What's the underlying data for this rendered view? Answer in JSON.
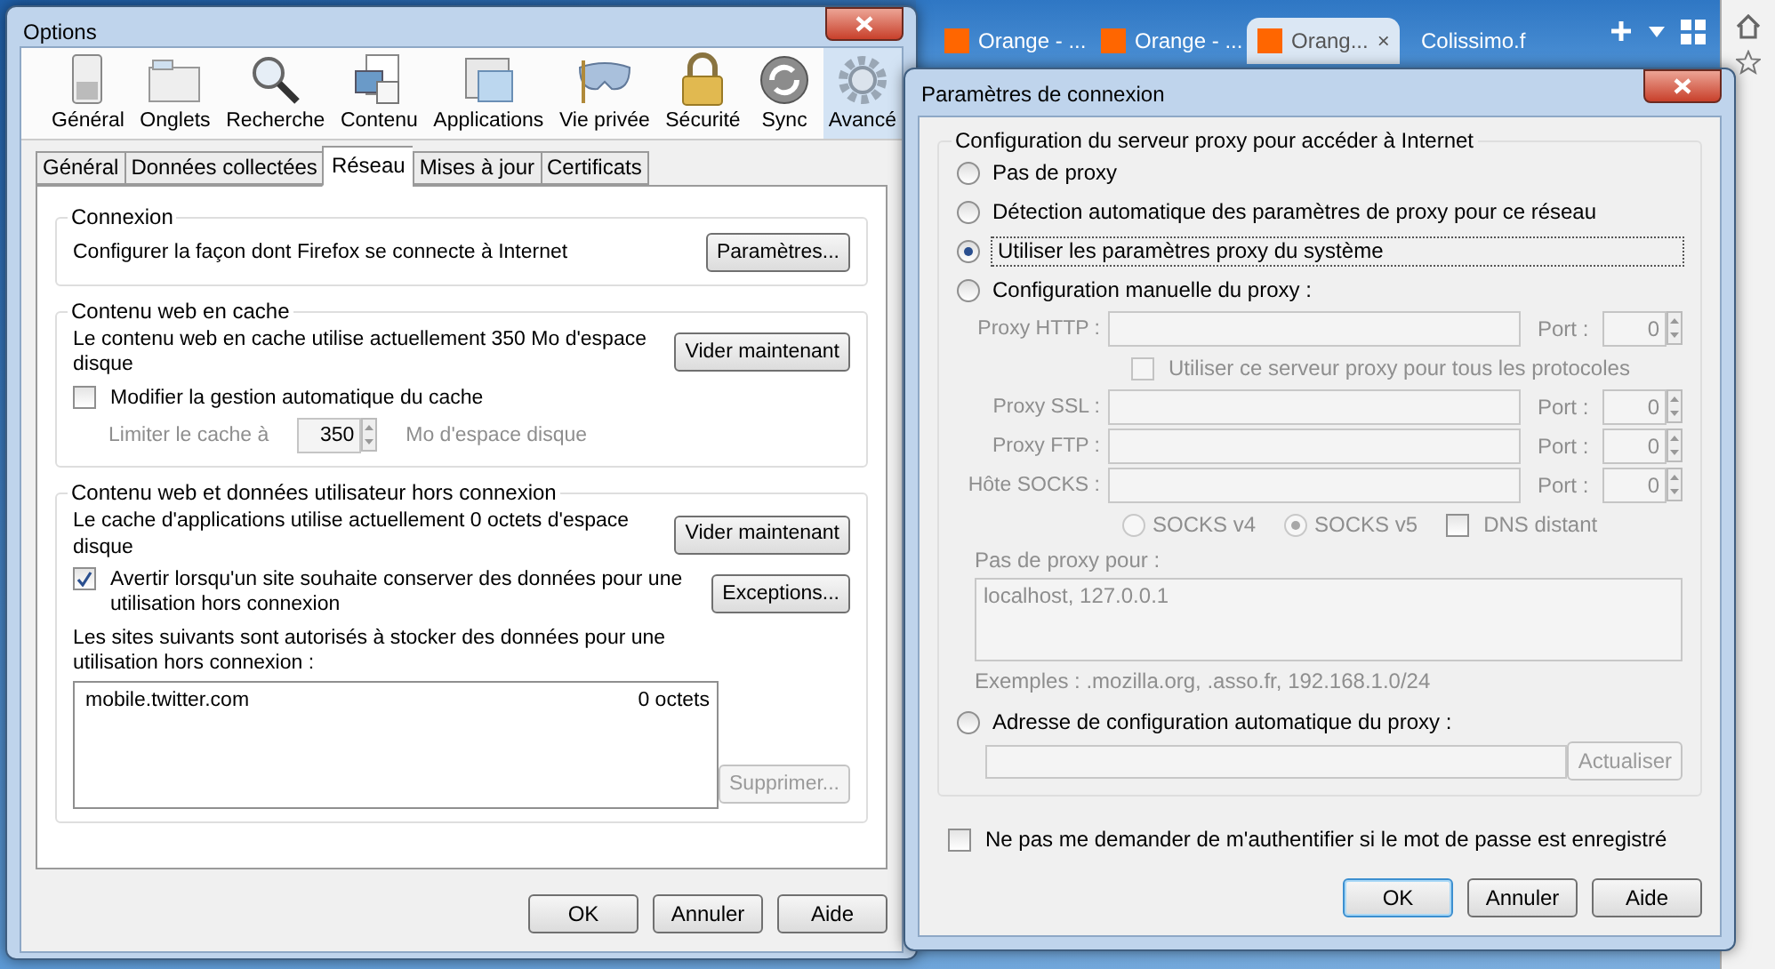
{
  "browser_tabs": [
    {
      "label": "Orange - ...",
      "favicon": true,
      "selected": false
    },
    {
      "label": "Orange - ...",
      "favicon": true,
      "selected": false
    },
    {
      "label": "Orang...",
      "favicon": true,
      "selected": true,
      "close": "×"
    },
    {
      "label": "Colissimo.f",
      "favicon": false,
      "selected": false
    }
  ],
  "options": {
    "title": "Options",
    "toolbar": [
      {
        "label": "Général",
        "kind": "general",
        "selected": false
      },
      {
        "label": "Onglets",
        "kind": "tabs",
        "selected": false
      },
      {
        "label": "Recherche",
        "kind": "search",
        "selected": false
      },
      {
        "label": "Contenu",
        "kind": "content",
        "selected": false
      },
      {
        "label": "Applications",
        "kind": "apps",
        "selected": false
      },
      {
        "label": "Vie privée",
        "kind": "privacy",
        "selected": false
      },
      {
        "label": "Sécurité",
        "kind": "security",
        "selected": false
      },
      {
        "label": "Sync",
        "kind": "sync",
        "selected": false
      },
      {
        "label": "Avancé",
        "kind": "advanced",
        "selected": true
      }
    ],
    "subtabs": [
      {
        "label": "Général",
        "selected": false
      },
      {
        "label": "Données collectées",
        "selected": false
      },
      {
        "label": "Réseau",
        "selected": true
      },
      {
        "label": "Mises à jour",
        "selected": false
      },
      {
        "label": "Certificats",
        "selected": false
      }
    ],
    "connexion": {
      "legend": "Connexion",
      "text": "Configurer la façon dont Firefox se connecte à Internet",
      "button": "Paramètres..."
    },
    "cache": {
      "legend": "Contenu web en cache",
      "text": "Le contenu web en cache utilise actuellement 350 Mo d'espace disque",
      "button": "Vider maintenant",
      "checkbox": {
        "label": "Modifier la gestion automatique du cache",
        "checked": false
      },
      "limit": {
        "label": "Limiter le cache à",
        "value": "350",
        "unit": "Mo d'espace disque",
        "disabled": true
      }
    },
    "offline": {
      "legend": "Contenu web et données utilisateur hors connexion",
      "text": "Le cache d'applications utilise actuellement 0 octets d'espace disque",
      "button": "Vider maintenant",
      "checkbox": {
        "label": "Avertir lorsqu'un site souhaite conserver des données pour une utilisation hors connexion",
        "checked": true
      },
      "exceptions_button": "Exceptions...",
      "sites_label": "Les sites suivants sont autorisés à stocker des données pour une utilisation hors connexion :",
      "sites": [
        {
          "site": "mobile.twitter.com",
          "size": "0 octets"
        }
      ],
      "remove_button": {
        "label": "Supprimer...",
        "disabled": true
      }
    },
    "buttons": [
      {
        "label": "OK",
        "default": false
      },
      {
        "label": "Annuler",
        "default": false
      },
      {
        "label": "Aide",
        "default": false
      }
    ]
  },
  "dialog": {
    "title": "Paramètres de connexion",
    "legend": "Configuration du serveur proxy pour accéder à Internet",
    "modes": [
      {
        "label": "Pas de proxy",
        "selected": false
      },
      {
        "label": "Détection automatique des paramètres de proxy pour ce réseau",
        "selected": false
      },
      {
        "label": "Utiliser les paramètres proxy du système",
        "selected": true
      },
      {
        "label": "Configuration manuelle du proxy :",
        "selected": false
      }
    ],
    "manual": {
      "disabled": true,
      "proxies": [
        {
          "label": "Proxy HTTP :",
          "port_label": "Port :",
          "port": "0"
        },
        {
          "label": "Proxy SSL :",
          "port_label": "Port :",
          "port": "0"
        },
        {
          "label": "Proxy FTP :",
          "port_label": "Port :",
          "port": "0"
        },
        {
          "label": "Hôte SOCKS :",
          "port_label": "Port :",
          "port": "0"
        }
      ],
      "share": {
        "label": "Utiliser ce serveur proxy pour tous les protocoles",
        "checked": false
      },
      "socks_versions": [
        {
          "label": "SOCKS v4",
          "selected": false
        },
        {
          "label": "SOCKS v5",
          "selected": true
        }
      ],
      "remote_dns": {
        "label": "DNS distant",
        "checked": false
      },
      "no_proxy_label": "Pas de proxy pour :",
      "no_proxy_value": "localhost, 127.0.0.1",
      "examples": "Exemples : .mozilla.org, .asso.fr, 192.168.1.0/24"
    },
    "auto": {
      "label": "Adresse de configuration automatique du proxy :",
      "selected": false,
      "disabled": true,
      "button": "Actualiser"
    },
    "no_auth": {
      "label": "Ne pas me demander de m'authentifier si le mot de passe est enregistré",
      "checked": false
    },
    "buttons": [
      {
        "label": "OK",
        "default": true
      },
      {
        "label": "Annuler",
        "default": false
      },
      {
        "label": "Aide",
        "default": false
      }
    ]
  }
}
